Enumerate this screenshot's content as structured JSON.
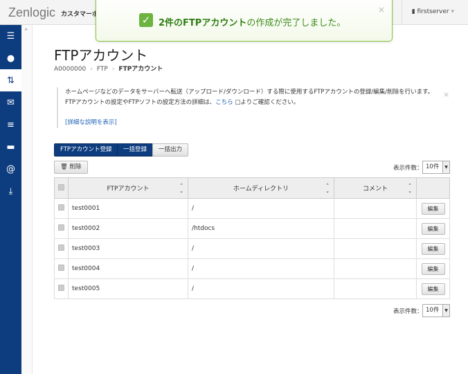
{
  "header": {
    "logo": "Zenlogic",
    "subtitle": "カスタマーポ",
    "user": "firstserver"
  },
  "sidebar": {
    "items": [
      "server-icon",
      "globe-icon",
      "transfer-icon",
      "mail-icon",
      "database-icon",
      "folder-icon",
      "at-icon",
      "download-icon"
    ],
    "expand": "»"
  },
  "toast": {
    "bold": "2件のFTPアカウント",
    "rest": "の作成が完了しました。",
    "close": "×"
  },
  "page": {
    "title": "FTPアカウント",
    "breadcrumb": [
      "A0000000",
      "FTP",
      "FTPアカウント"
    ]
  },
  "info": {
    "line1": "ホームページなどのデータをサーバーへ転送（アップロード/ダウンロード）する際に使用するFTPアカウントの登録/編集/削除を行います。",
    "line2a": "FTPアカウントの設定やFTPソフトの設定方法の詳細は、",
    "link": "こちら",
    "line2b": " □よりご確認ください。",
    "detail": "[詳細な説明を表示]",
    "close": "×"
  },
  "toolbar": {
    "register": "FTPアカウント登録",
    "bulk_register": "一括登録",
    "bulk_export": "一括出力",
    "delete": "🗑 削除",
    "count_label": "表示件数：",
    "count_value": "10件"
  },
  "table": {
    "headers": [
      "FTPアカウント",
      "ホームディレクトリ",
      "コメント"
    ],
    "edit_label": "編集",
    "rows": [
      {
        "account": "test0001",
        "dir": "/",
        "comment": ""
      },
      {
        "account": "test0002",
        "dir": "/htdocs",
        "comment": ""
      },
      {
        "account": "test0003",
        "dir": "/",
        "comment": ""
      },
      {
        "account": "test0004",
        "dir": "/",
        "comment": ""
      },
      {
        "account": "test0005",
        "dir": "/",
        "comment": ""
      }
    ]
  },
  "colors": {
    "sidebar": "#0e3d7f",
    "success": "#6cb33f",
    "primary": "#0e3d7f"
  }
}
